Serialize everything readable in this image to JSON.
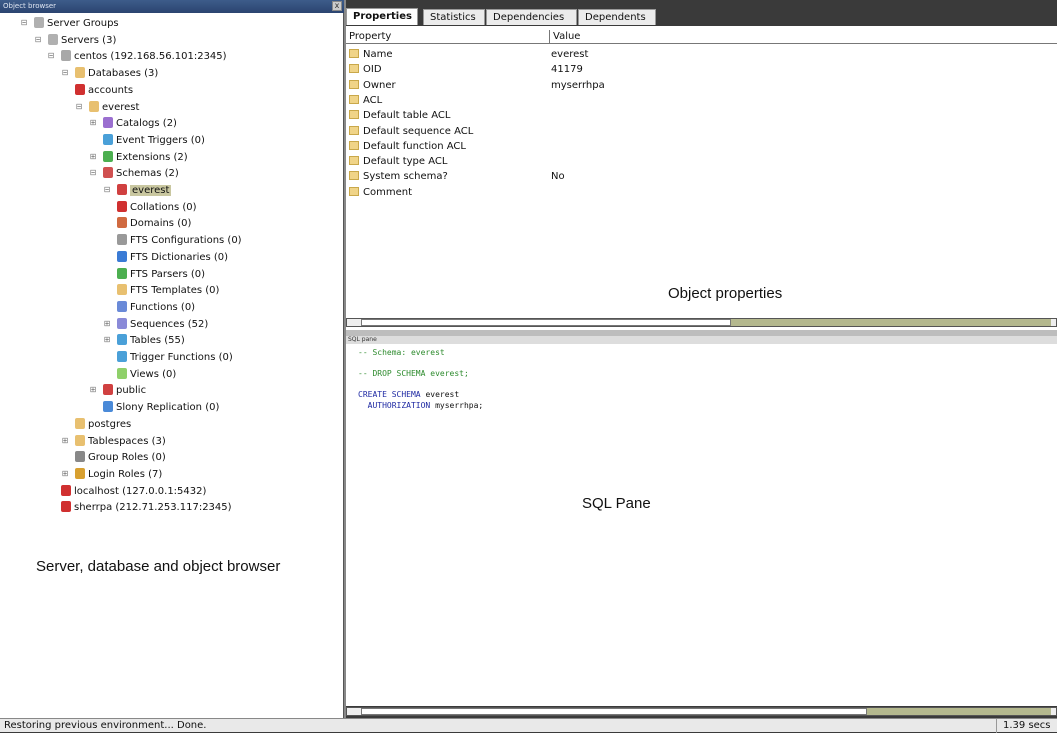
{
  "left_panel": {
    "title": "Object browser",
    "close_glyph": "x",
    "caption": "Server, database and object browser",
    "tree": [
      {
        "label": "Server Groups",
        "icon": "server-groups-icon",
        "exp": "minus"
      },
      {
        "label": "Servers (3)",
        "icon": "servers-icon",
        "exp": "minus"
      },
      {
        "label": "centos (192.168.56.101:2345)",
        "icon": "server-icon",
        "exp": "minus"
      },
      {
        "label": "Databases (3)",
        "icon": "databases-icon",
        "exp": "minus"
      },
      {
        "label": "accounts",
        "icon": "database-disconnected-icon",
        "exp": ""
      },
      {
        "label": "everest",
        "icon": "database-icon",
        "exp": "minus"
      },
      {
        "label": "Catalogs (2)",
        "icon": "catalogs-icon",
        "exp": "plus"
      },
      {
        "label": "Event Triggers (0)",
        "icon": "event-triggers-icon",
        "exp": ""
      },
      {
        "label": "Extensions (2)",
        "icon": "extensions-icon",
        "exp": "plus"
      },
      {
        "label": "Schemas (2)",
        "icon": "schemas-icon",
        "exp": "minus"
      },
      {
        "label": "everest",
        "icon": "schema-icon",
        "exp": "minus",
        "selected": true
      },
      {
        "label": "Collations (0)",
        "icon": "collations-icon",
        "exp": ""
      },
      {
        "label": "Domains (0)",
        "icon": "domains-icon",
        "exp": ""
      },
      {
        "label": "FTS Configurations (0)",
        "icon": "fts-configurations-icon",
        "exp": ""
      },
      {
        "label": "FTS Dictionaries (0)",
        "icon": "fts-dictionaries-icon",
        "exp": ""
      },
      {
        "label": "FTS Parsers (0)",
        "icon": "fts-parsers-icon",
        "exp": ""
      },
      {
        "label": "FTS Templates (0)",
        "icon": "fts-templates-icon",
        "exp": ""
      },
      {
        "label": "Functions (0)",
        "icon": "functions-icon",
        "exp": ""
      },
      {
        "label": "Sequences (52)",
        "icon": "sequences-icon",
        "exp": "plus"
      },
      {
        "label": "Tables (55)",
        "icon": "tables-icon",
        "exp": "plus"
      },
      {
        "label": "Trigger Functions (0)",
        "icon": "trigger-functions-icon",
        "exp": ""
      },
      {
        "label": "Views (0)",
        "icon": "views-icon",
        "exp": ""
      },
      {
        "label": "public",
        "icon": "schema-icon",
        "exp": "plus"
      },
      {
        "label": "Slony Replication (0)",
        "icon": "slony-replication-icon",
        "exp": ""
      },
      {
        "label": "postgres",
        "icon": "database-icon",
        "exp": ""
      },
      {
        "label": "Tablespaces (3)",
        "icon": "tablespaces-icon",
        "exp": "plus"
      },
      {
        "label": "Group Roles (0)",
        "icon": "group-roles-icon",
        "exp": ""
      },
      {
        "label": "Login Roles (7)",
        "icon": "login-roles-icon",
        "exp": "plus"
      },
      {
        "label": "localhost (127.0.0.1:5432)",
        "icon": "server-disconnected-icon",
        "exp": ""
      },
      {
        "label": "sherrpa (212.71.253.117:2345)",
        "icon": "server-disconnected-icon",
        "exp": ""
      }
    ]
  },
  "tabs": [
    {
      "label": "Properties",
      "active": true
    },
    {
      "label": "Statistics",
      "active": false
    },
    {
      "label": "Dependencies",
      "active": false
    },
    {
      "label": "Dependents",
      "active": false
    }
  ],
  "properties": {
    "header": {
      "property": "Property",
      "value": "Value"
    },
    "rows": [
      {
        "name": "Name",
        "value": "everest"
      },
      {
        "name": "OID",
        "value": "41179"
      },
      {
        "name": "Owner",
        "value": "myserrhpa"
      },
      {
        "name": "ACL",
        "value": ""
      },
      {
        "name": "Default table ACL",
        "value": ""
      },
      {
        "name": "Default sequence ACL",
        "value": ""
      },
      {
        "name": "Default function ACL",
        "value": ""
      },
      {
        "name": "Default type ACL",
        "value": ""
      },
      {
        "name": "System schema?",
        "value": "No"
      },
      {
        "name": "Comment",
        "value": ""
      }
    ],
    "caption": "Object properties"
  },
  "sql_pane": {
    "title": "SQL pane",
    "lines": [
      {
        "text": "-- Schema: everest",
        "kind": "comment"
      },
      {
        "text": "",
        "kind": "plain"
      },
      {
        "text": "-- DROP SCHEMA everest;",
        "kind": "comment"
      },
      {
        "text": "",
        "kind": "plain"
      },
      {
        "kw": "CREATE SCHEMA",
        "text": " everest",
        "kind": "kw"
      },
      {
        "kw": "  AUTHORIZATION",
        "text": " myserrhpa;",
        "kind": "kw"
      }
    ],
    "caption": "SQL Pane"
  },
  "statusbar": {
    "text": "Restoring previous environment... Done.",
    "time": "1.39 secs"
  },
  "colors": {
    "selected_bg": "#c9c7a0",
    "sql_comment": "#2e8b2e",
    "sql_keyword": "#1f2aa3",
    "title_bar": "#3d5c8a"
  }
}
